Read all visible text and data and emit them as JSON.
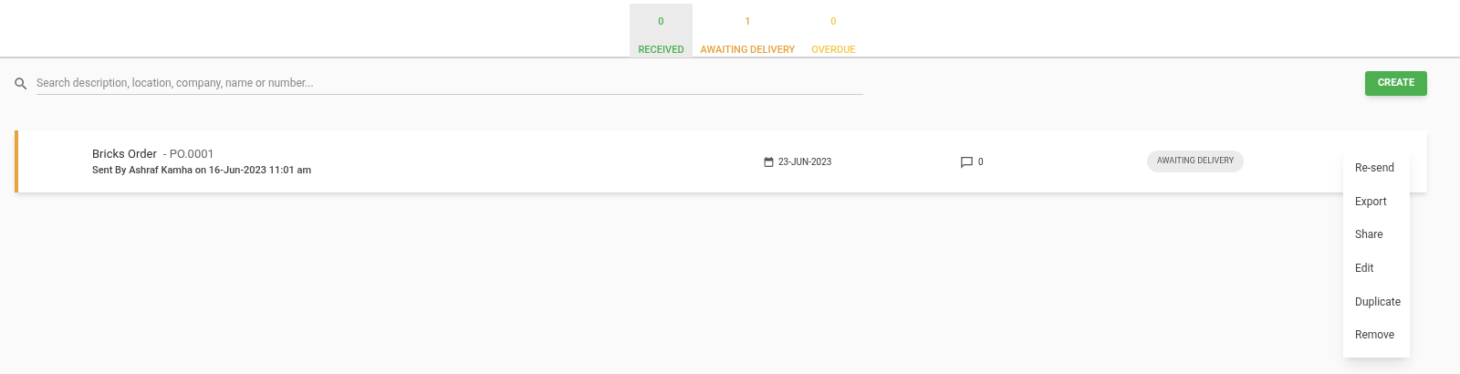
{
  "status_tabs": [
    {
      "count": "0",
      "label": "RECEIVED",
      "color": "#4caf50",
      "selected": true
    },
    {
      "count": "1",
      "label": "AWAITING DELIVERY",
      "color": "#e6a23c",
      "selected": false
    },
    {
      "count": "0",
      "label": "OVERDUE",
      "color": "#f2c94c",
      "selected": false
    }
  ],
  "search": {
    "placeholder": "Search description, location, company, name or number..."
  },
  "create_button": "CREATE",
  "orders": [
    {
      "title": "Bricks Order",
      "number": "- PO.0001",
      "sent_by": "Sent By Ashraf Kamha on 16-Jun-2023 11:01 am",
      "date": "23-JUN-2023",
      "comments": "0",
      "status": "AWAITING DELIVERY",
      "color": "#e6a23c"
    }
  ],
  "menu": [
    "Re-send",
    "Export",
    "Share",
    "Edit",
    "Duplicate",
    "Remove"
  ]
}
